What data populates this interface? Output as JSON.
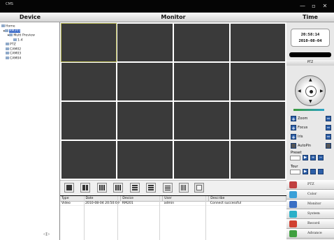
{
  "window": {
    "title": "CMS",
    "minimize": "—",
    "restore": "▫",
    "close": "✕"
  },
  "headers": {
    "device": "Device",
    "monitor": "Monitor",
    "time": "Time"
  },
  "tree": [
    {
      "label": "Home",
      "indent": 0
    },
    {
      "label": "RM201",
      "indent": 1
    },
    {
      "label": "Multi Preview",
      "indent": 2
    },
    {
      "label": "1-4",
      "indent": 3
    },
    {
      "label": "PTZ",
      "indent": 2
    },
    {
      "label": "CAM02",
      "indent": 2
    },
    {
      "label": "CAM03",
      "indent": 2
    },
    {
      "label": "CAM04",
      "indent": 2
    }
  ],
  "scroll": {
    "left": "◁",
    "right": "▷"
  },
  "clock": {
    "time": "20:58:14",
    "date": "2010-08-04"
  },
  "ptz": {
    "header": "PTZ",
    "up": "▲",
    "down": "▼",
    "left": "◀",
    "right": "▶",
    "zoom": "Zoom",
    "focus": "Focus",
    "iris": "Iris",
    "autopin": "AutoPin",
    "preset": "Preset",
    "tour": "Tour",
    "plus": "+",
    "minus": "−"
  },
  "menu": [
    {
      "label": "PTZ",
      "color": "#c04040"
    },
    {
      "label": "Color",
      "color": "#3aa0d8"
    },
    {
      "label": "Monitor",
      "color": "#3a6fc4"
    },
    {
      "label": "System",
      "color": "#2ab0c8"
    },
    {
      "label": "Record",
      "color": "#d04030"
    },
    {
      "label": "Advance",
      "color": "#40a040"
    }
  ],
  "log": {
    "columns": [
      "Type",
      "Date",
      "Device",
      "User",
      "Describe"
    ],
    "rows": [
      [
        "Video",
        "2010-08-04 20:50:09",
        "RM201",
        "admin",
        "Connect successful"
      ]
    ]
  }
}
